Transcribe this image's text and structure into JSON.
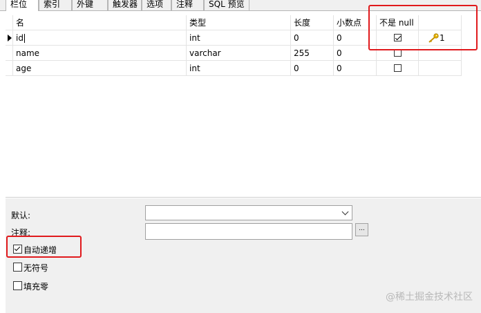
{
  "tabs": [
    {
      "label": "栏位",
      "active": true
    },
    {
      "label": "索引",
      "active": false
    },
    {
      "label": "外键",
      "active": false
    },
    {
      "label": "触发器",
      "active": false
    },
    {
      "label": "选项",
      "active": false
    },
    {
      "label": "注释",
      "active": false
    },
    {
      "label": "SQL 预览",
      "active": false
    }
  ],
  "grid": {
    "headers": {
      "name": "名",
      "type": "类型",
      "length": "长度",
      "decimals": "小数点",
      "not_null": "不是 null",
      "key": ""
    },
    "rows": [
      {
        "name": "id",
        "type": "int",
        "length": "0",
        "decimals": "0",
        "not_null": true,
        "key_icon": "key-icon",
        "key_number": "1",
        "current": true
      },
      {
        "name": "name",
        "type": "varchar",
        "length": "255",
        "decimals": "0",
        "not_null": false,
        "key_icon": "",
        "key_number": "",
        "current": false
      },
      {
        "name": "age",
        "type": "int",
        "length": "0",
        "decimals": "0",
        "not_null": false,
        "key_icon": "",
        "key_number": "",
        "current": false
      }
    ]
  },
  "properties": {
    "default_label": "默认:",
    "default_value": "",
    "comment_label": "注释:",
    "comment_value": "",
    "ellipsis_label": "...",
    "auto_increment_label": "自动递增",
    "auto_increment_checked": true,
    "unsigned_label": "无符号",
    "unsigned_checked": false,
    "zerofill_label": "填充零",
    "zerofill_checked": false
  },
  "watermark": "@稀土掘金技术社区",
  "colors": {
    "highlight_box": "#e0191c",
    "key_icon": "#e8b400",
    "panel_bg": "#f0f0f0"
  }
}
